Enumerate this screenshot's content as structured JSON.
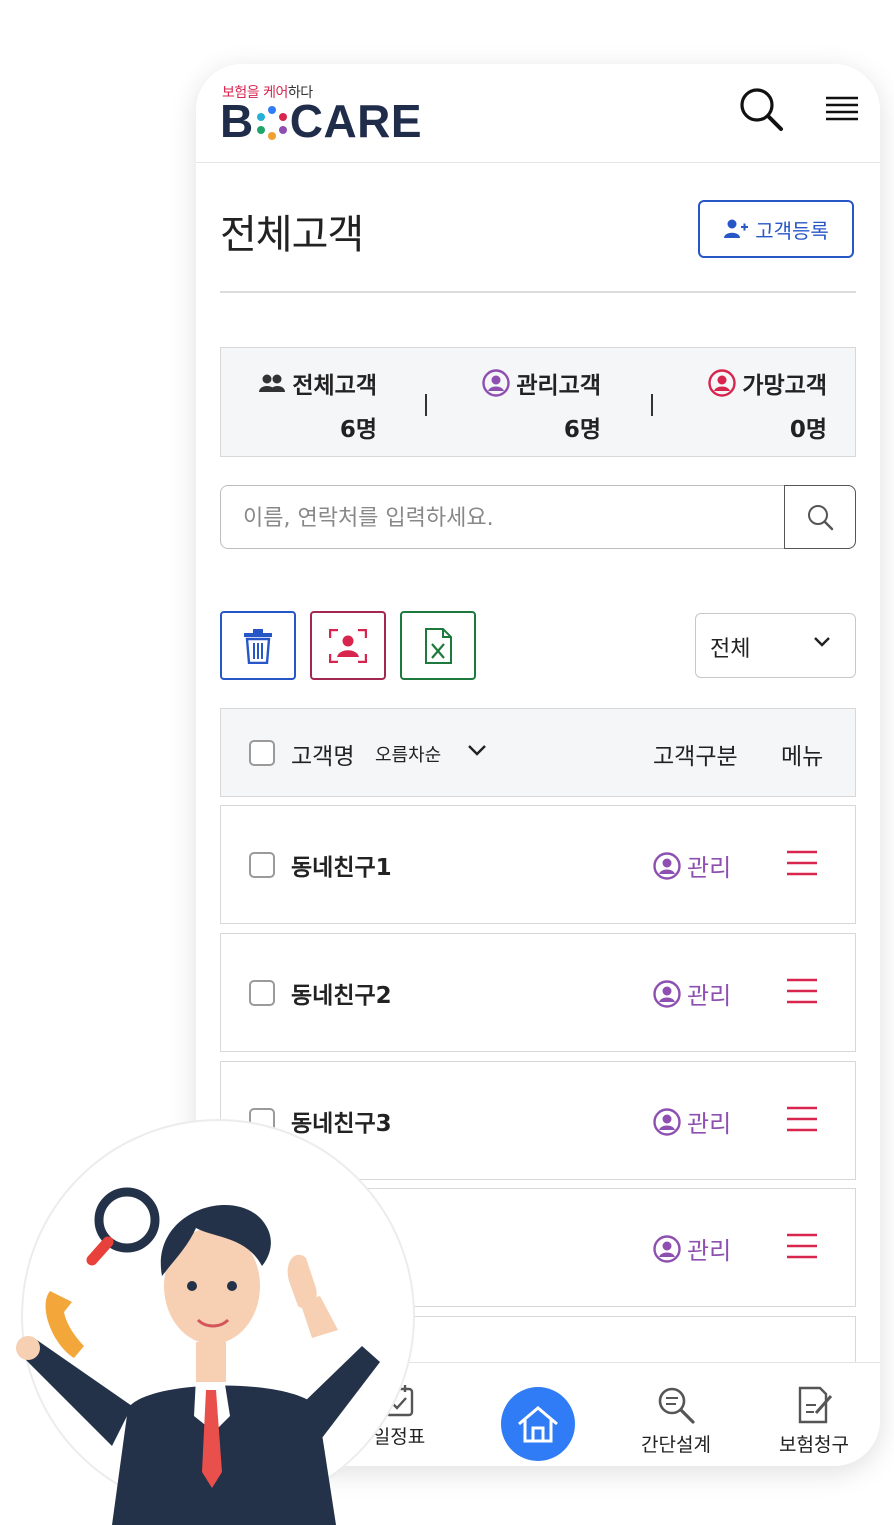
{
  "header": {
    "tagline_part1": "보험을 ",
    "tagline_part2": "케어",
    "tagline_part3": "하다",
    "logo_left": "B",
    "logo_right": "CARE",
    "search_icon": "search-icon",
    "menu_icon": "hamburger-menu-icon"
  },
  "page": {
    "title": "전체고객",
    "register_button": "고객등록"
  },
  "stats": [
    {
      "label": "전체고객",
      "value": "6명",
      "icon": "people-icon",
      "color": "#333333"
    },
    {
      "label": "관리고객",
      "value": "6명",
      "icon": "user-circle-icon",
      "color": "#8d4fb0"
    },
    {
      "label": "가망고객",
      "value": "0명",
      "icon": "user-circle-icon",
      "color": "#d7254e"
    }
  ],
  "search": {
    "placeholder": "이름, 연락처를 입력하세요."
  },
  "toolbar": {
    "delete_icon": "trash-icon",
    "scan_icon": "scan-contact-icon",
    "excel_icon": "excel-file-icon",
    "filter_value": "전체"
  },
  "table": {
    "col_name": "고객명",
    "sort_label": "오름차순",
    "col_type": "고객구분",
    "col_menu": "메뉴",
    "rows": [
      {
        "name": "동네친구1",
        "type": "관리"
      },
      {
        "name": "동네친구2",
        "type": "관리"
      },
      {
        "name": "동네친구3",
        "type": "관리"
      },
      {
        "name": "",
        "type": "관리"
      }
    ]
  },
  "bottom_nav": {
    "schedule": "일정표",
    "home": "home-icon",
    "quick_design": "간단설계",
    "claim": "보험청구"
  },
  "colors": {
    "primary_blue": "#2756c7",
    "accent_red": "#d7254e",
    "manage_purple": "#8d4fb0",
    "excel_green": "#1e7a3c",
    "home_blue": "#2f7cf6"
  }
}
